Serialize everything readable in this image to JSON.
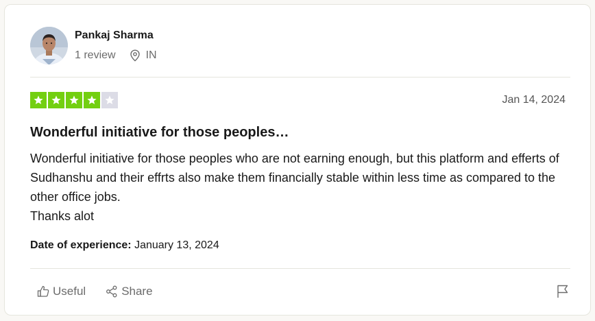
{
  "user": {
    "name": "Pankaj Sharma",
    "review_count": "1 review",
    "country": "IN"
  },
  "review": {
    "rating": 4,
    "max_rating": 5,
    "date": "Jan 14, 2024",
    "title": "Wonderful initiative for those peoples…",
    "body_line1": "Wonderful initiative for those peoples who are not earning enough, but this platform and efferts of Sudhanshu and their effrts also make them financially stable within less time as compared to the other office jobs.",
    "body_line2": "Thanks alot",
    "experience_label": "Date of experience:",
    "experience_date": "January 13, 2024"
  },
  "actions": {
    "useful_label": "Useful",
    "share_label": "Share"
  },
  "colors": {
    "star_filled": "#73cf11",
    "star_empty": "#dcdce6"
  }
}
